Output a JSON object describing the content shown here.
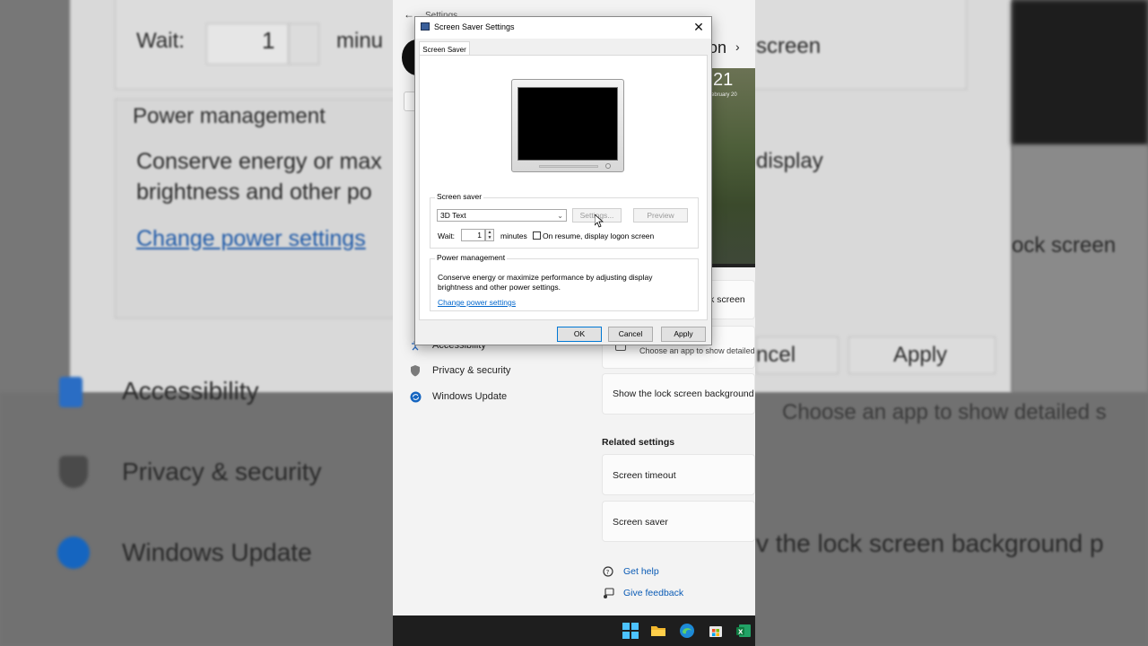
{
  "background": {
    "wait_label": "Wait:",
    "wait_value": "1",
    "minutes_fragment": "minu",
    "power_management": "Power management",
    "pm_desc_line1": "Conserve energy or max",
    "pm_desc_line2": "brightness and other po",
    "change_power": "Change power settings",
    "heading_fragment": "n",
    "screen_fragment": "screen",
    "display_fragment": "display",
    "lock_screen_fragment": "ock screen",
    "cancel_fragment": "ncel",
    "apply": "Apply",
    "choose_app_fragment": "Choose an app to show detailed s",
    "accessibility": "Accessibility",
    "privacy": "Privacy & security",
    "windows_update": "Windows Update",
    "lock_bg_fragment": "v the lock screen background p"
  },
  "settings": {
    "title": "Settings",
    "back_glyph": "←",
    "heading_fragment": "on",
    "chevron": "›",
    "hero_number": "21",
    "hero_date": "ebruary 20",
    "nav": {
      "accessibility": "Accessibility",
      "privacy": "Privacy & security",
      "windows_update": "Windows Update"
    },
    "lock_screen_fragment": "ock screen",
    "cancel_fragment": "ncel",
    "choose_app": "Choose an app to show detailed",
    "show_lock_bg": "Show the lock screen background p",
    "related_settings": "Related settings",
    "screen_timeout": "Screen timeout",
    "screen_saver": "Screen saver",
    "get_help": "Get help",
    "give_feedback": "Give feedback"
  },
  "dialog": {
    "title": "Screen Saver Settings",
    "close_glyph": "✕",
    "tab_label": "Screen Saver",
    "screen_saver_group": "Screen saver",
    "selected_saver": "3D Text",
    "settings_button": "Settings...",
    "preview_button": "Preview",
    "wait_label": "Wait:",
    "wait_value": "1",
    "minutes_label": "minutes",
    "resume_label": "On resume, display logon screen",
    "power_group": "Power management",
    "power_desc": "Conserve energy or maximize performance by adjusting display brightness and other power settings.",
    "power_link": "Change power settings",
    "ok": "OK",
    "cancel": "Cancel",
    "apply": "Apply"
  },
  "colors": {
    "accent": "#0078d4",
    "link": "#0066cc",
    "taskbar": "#1e1e1e"
  },
  "taskbar_icons": [
    "windows-start-icon",
    "file-explorer-icon",
    "edge-browser-icon",
    "store-icon",
    "excel-icon"
  ]
}
